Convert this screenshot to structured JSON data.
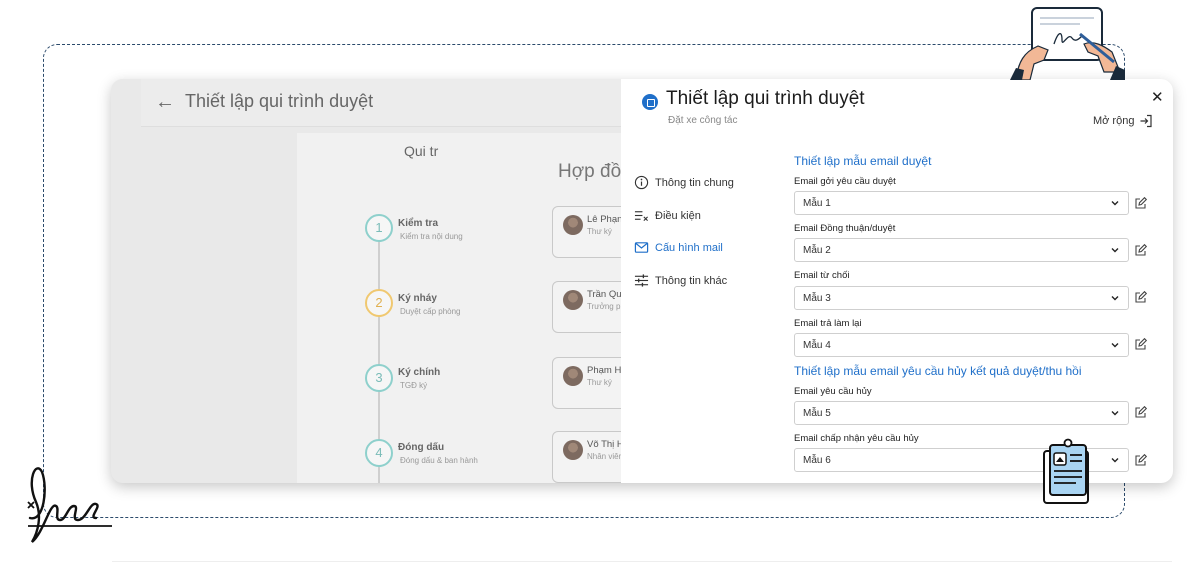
{
  "background": {
    "title": "Thiết lập qui trình duyệt",
    "doc_title_line1": "Qui tr",
    "doc_title_line2": "Hợp đồn",
    "steps": [
      {
        "number": "1",
        "name": "Kiểm tra",
        "sub": "Kiểm tra nội dung",
        "person": "Lê Phạn",
        "role": "Thư ký"
      },
      {
        "number": "2",
        "name": "Ký nháy",
        "sub": "Duyệt cấp phòng",
        "person": "Trần Qu",
        "role": "Trưởng p"
      },
      {
        "number": "3",
        "name": "Ký chính",
        "sub": "TGĐ ký",
        "person": "Phạm H",
        "role": "Thư ký"
      },
      {
        "number": "4",
        "name": "Đóng dấu",
        "sub": "Đóng dấu & ban hành",
        "person": "Võ Thị H",
        "role": "Nhân viên"
      }
    ]
  },
  "panel": {
    "title": "Thiết lập qui trình duyệt",
    "subtitle": "Đặt xe công tác",
    "expand_label": "Mở rộng",
    "nav": [
      {
        "label": "Thông tin chung",
        "icon": "info-icon",
        "active": false
      },
      {
        "label": "Điều kiện",
        "icon": "condition-list-icon",
        "active": false
      },
      {
        "label": "Cấu hình mail",
        "icon": "mail-icon",
        "active": true
      },
      {
        "label": "Thông tin khác",
        "icon": "sliders-icon",
        "active": false
      }
    ],
    "section1_title": "Thiết lập mẫu email duyệt",
    "section2_title": "Thiết lập mẫu email yêu cầu hủy kết quả duyệt/thu hồi",
    "fields": [
      {
        "label": "Email gởi yêu cầu duyệt",
        "value": "Mẫu 1"
      },
      {
        "label": "Email Đồng thuận/duyệt",
        "value": "Mẫu 2"
      },
      {
        "label": "Email từ chối",
        "value": "Mẫu 3"
      },
      {
        "label": "Email trả làm lại",
        "value": "Mẫu 4"
      },
      {
        "label": "Email yêu cầu hủy",
        "value": "Mẫu 5"
      },
      {
        "label": "Email chấp nhận yêu cầu hủy",
        "value": "Mẫu 6"
      }
    ]
  },
  "colors": {
    "accent": "#1f6fc9",
    "frame": "#2b4a6b",
    "teal": "#8ed0cc",
    "yellow": "#f0c870"
  }
}
